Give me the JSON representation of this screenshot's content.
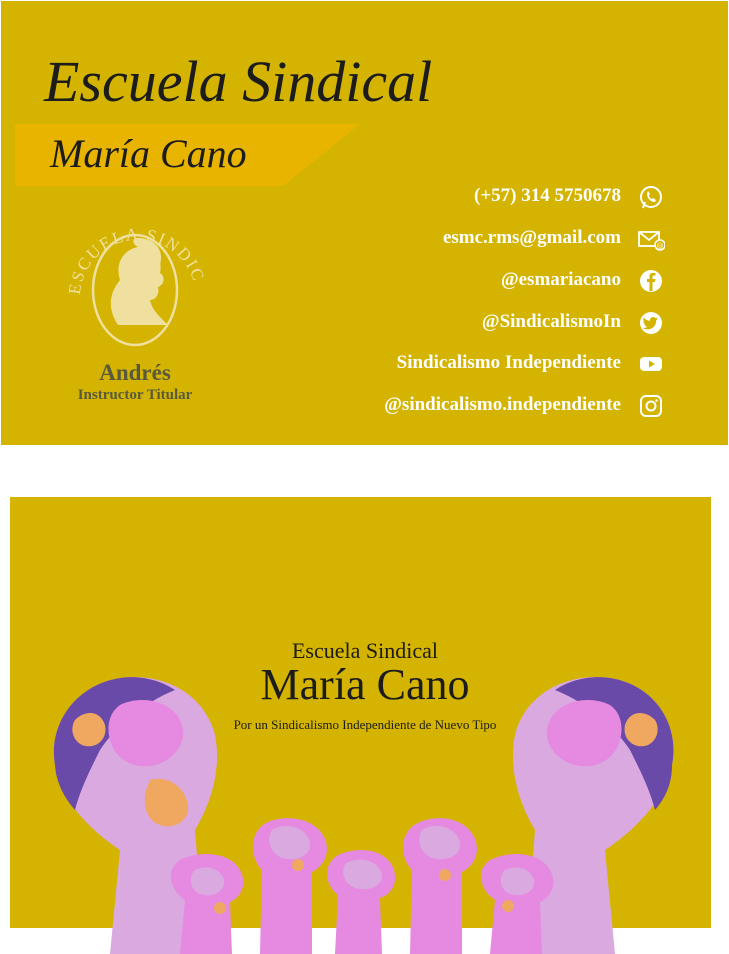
{
  "front": {
    "title": "Escuela Sindical",
    "subtitle": "María Cano",
    "logo_text": "ESCUELA SINDICAL",
    "person_name": "Andrés",
    "person_role": "Instructor Titular",
    "contacts": [
      {
        "text": "(+57) 314 5750678",
        "icon": "whatsapp-icon"
      },
      {
        "text": "esmc.rms@gmail.com",
        "icon": "email-icon"
      },
      {
        "text": "@esmariacano",
        "icon": "facebook-icon"
      },
      {
        "text": "@SindicalismoIn",
        "icon": "twitter-icon"
      },
      {
        "text": "Sindicalismo Independiente",
        "icon": "youtube-icon"
      },
      {
        "text": "@sindicalismo.independiente",
        "icon": "instagram-icon"
      }
    ]
  },
  "back": {
    "heading": "Escuela Sindical",
    "title": "María Cano",
    "tagline": "Por un Sindicalismo Independiente de Nuevo Tipo"
  },
  "colors": {
    "card_bg": "#d4b400",
    "banner": "#e8b400",
    "fist_light": "#d9a9e0",
    "fist_pink": "#e58ae0",
    "fist_dark": "#6a4aa8",
    "fist_orange": "#f0a860"
  }
}
